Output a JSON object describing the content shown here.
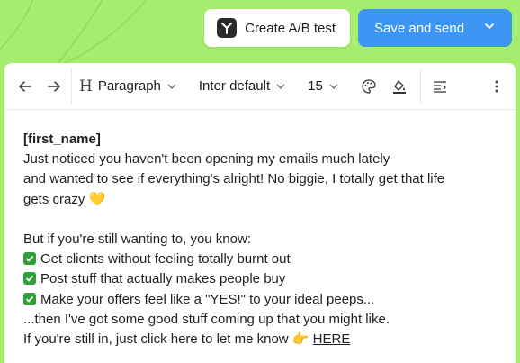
{
  "header": {
    "ab_test_label": "Create A/B test",
    "send_label": "Save and send"
  },
  "toolbar": {
    "block_type": "Paragraph",
    "font_family": "Inter default",
    "font_size": "15"
  },
  "email": {
    "greeting": "[first_name]",
    "line1": "Just noticed you haven't been opening my emails much lately",
    "line2": "and wanted to see if everything's alright! No biggie, I totally get that life",
    "line3": "gets crazy",
    "line3_emoji": "💛",
    "line4": "But if you're still wanting to, you know:",
    "bullets": [
      "Get clients without feeling totally burnt out",
      "Post stuff that actually makes people buy",
      "Make your offers feel like a \"YES!\" to your ideal peeps..."
    ],
    "line5": "...then I've got some good stuff coming up that you might like.",
    "line6": "If you're still in, just click here to let me know",
    "line6_emoji": "👉",
    "link_text": "HERE"
  },
  "colors": {
    "background": "#a6ec6e",
    "send_button": "#3b97f3",
    "check": "#2f9e3b"
  }
}
